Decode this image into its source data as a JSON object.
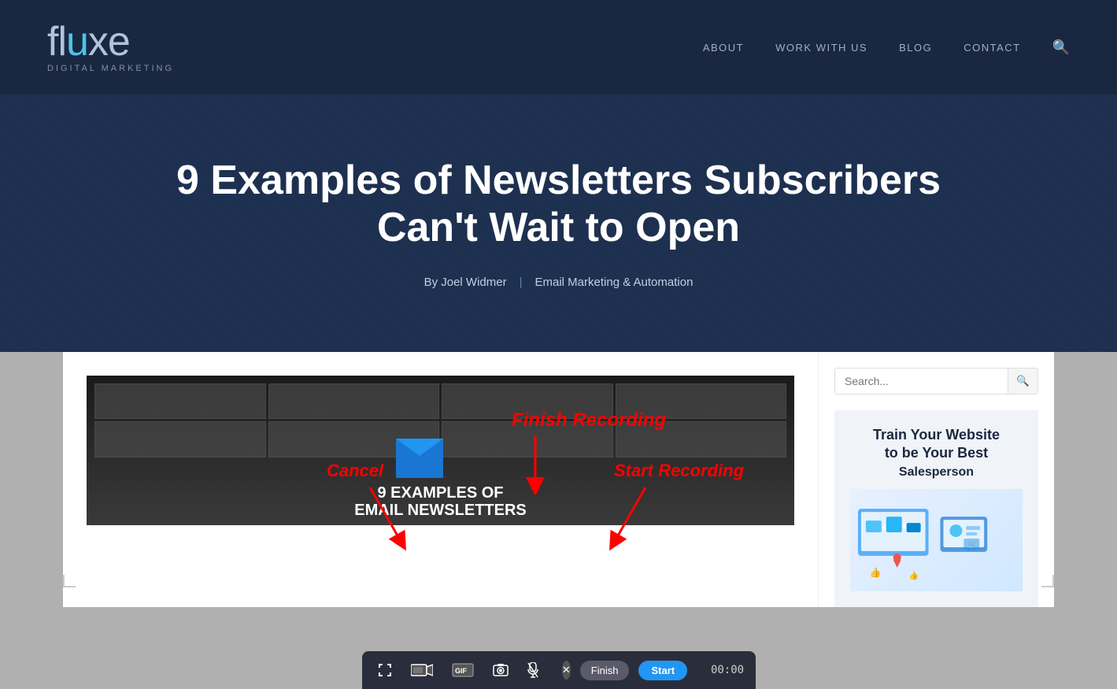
{
  "header": {
    "logo": {
      "text_prefix": "fl",
      "text_highlight": "u",
      "text_suffix": "xe",
      "subtitle": "DIGITAL MARKETING"
    },
    "nav": {
      "items": [
        {
          "label": "ABOUT",
          "id": "about"
        },
        {
          "label": "WORK WITH US",
          "id": "work-with-us"
        },
        {
          "label": "BLOG",
          "id": "blog"
        },
        {
          "label": "CONTACT",
          "id": "contact"
        }
      ]
    }
  },
  "hero": {
    "title": "9 Examples of Newsletters Subscribers Can't Wait to Open",
    "author": "By Joel Widmer",
    "separator": "|",
    "category": "Email Marketing & Automation"
  },
  "annotations": {
    "finish_recording": "Finish Recording",
    "cancel": "Cancel",
    "start_recording": "Start Recording"
  },
  "toolbar": {
    "timer": "00:00",
    "finish_label": "Finish",
    "start_label": "Start"
  },
  "article_image": {
    "bottom_line1": "9 EXAMPLES OF",
    "bottom_line2": "EMAIL NEWSLETTERS"
  },
  "sidebar": {
    "search_placeholder": "Search...",
    "promo_title": "Train Your Website to be Your Best Salesperson"
  }
}
